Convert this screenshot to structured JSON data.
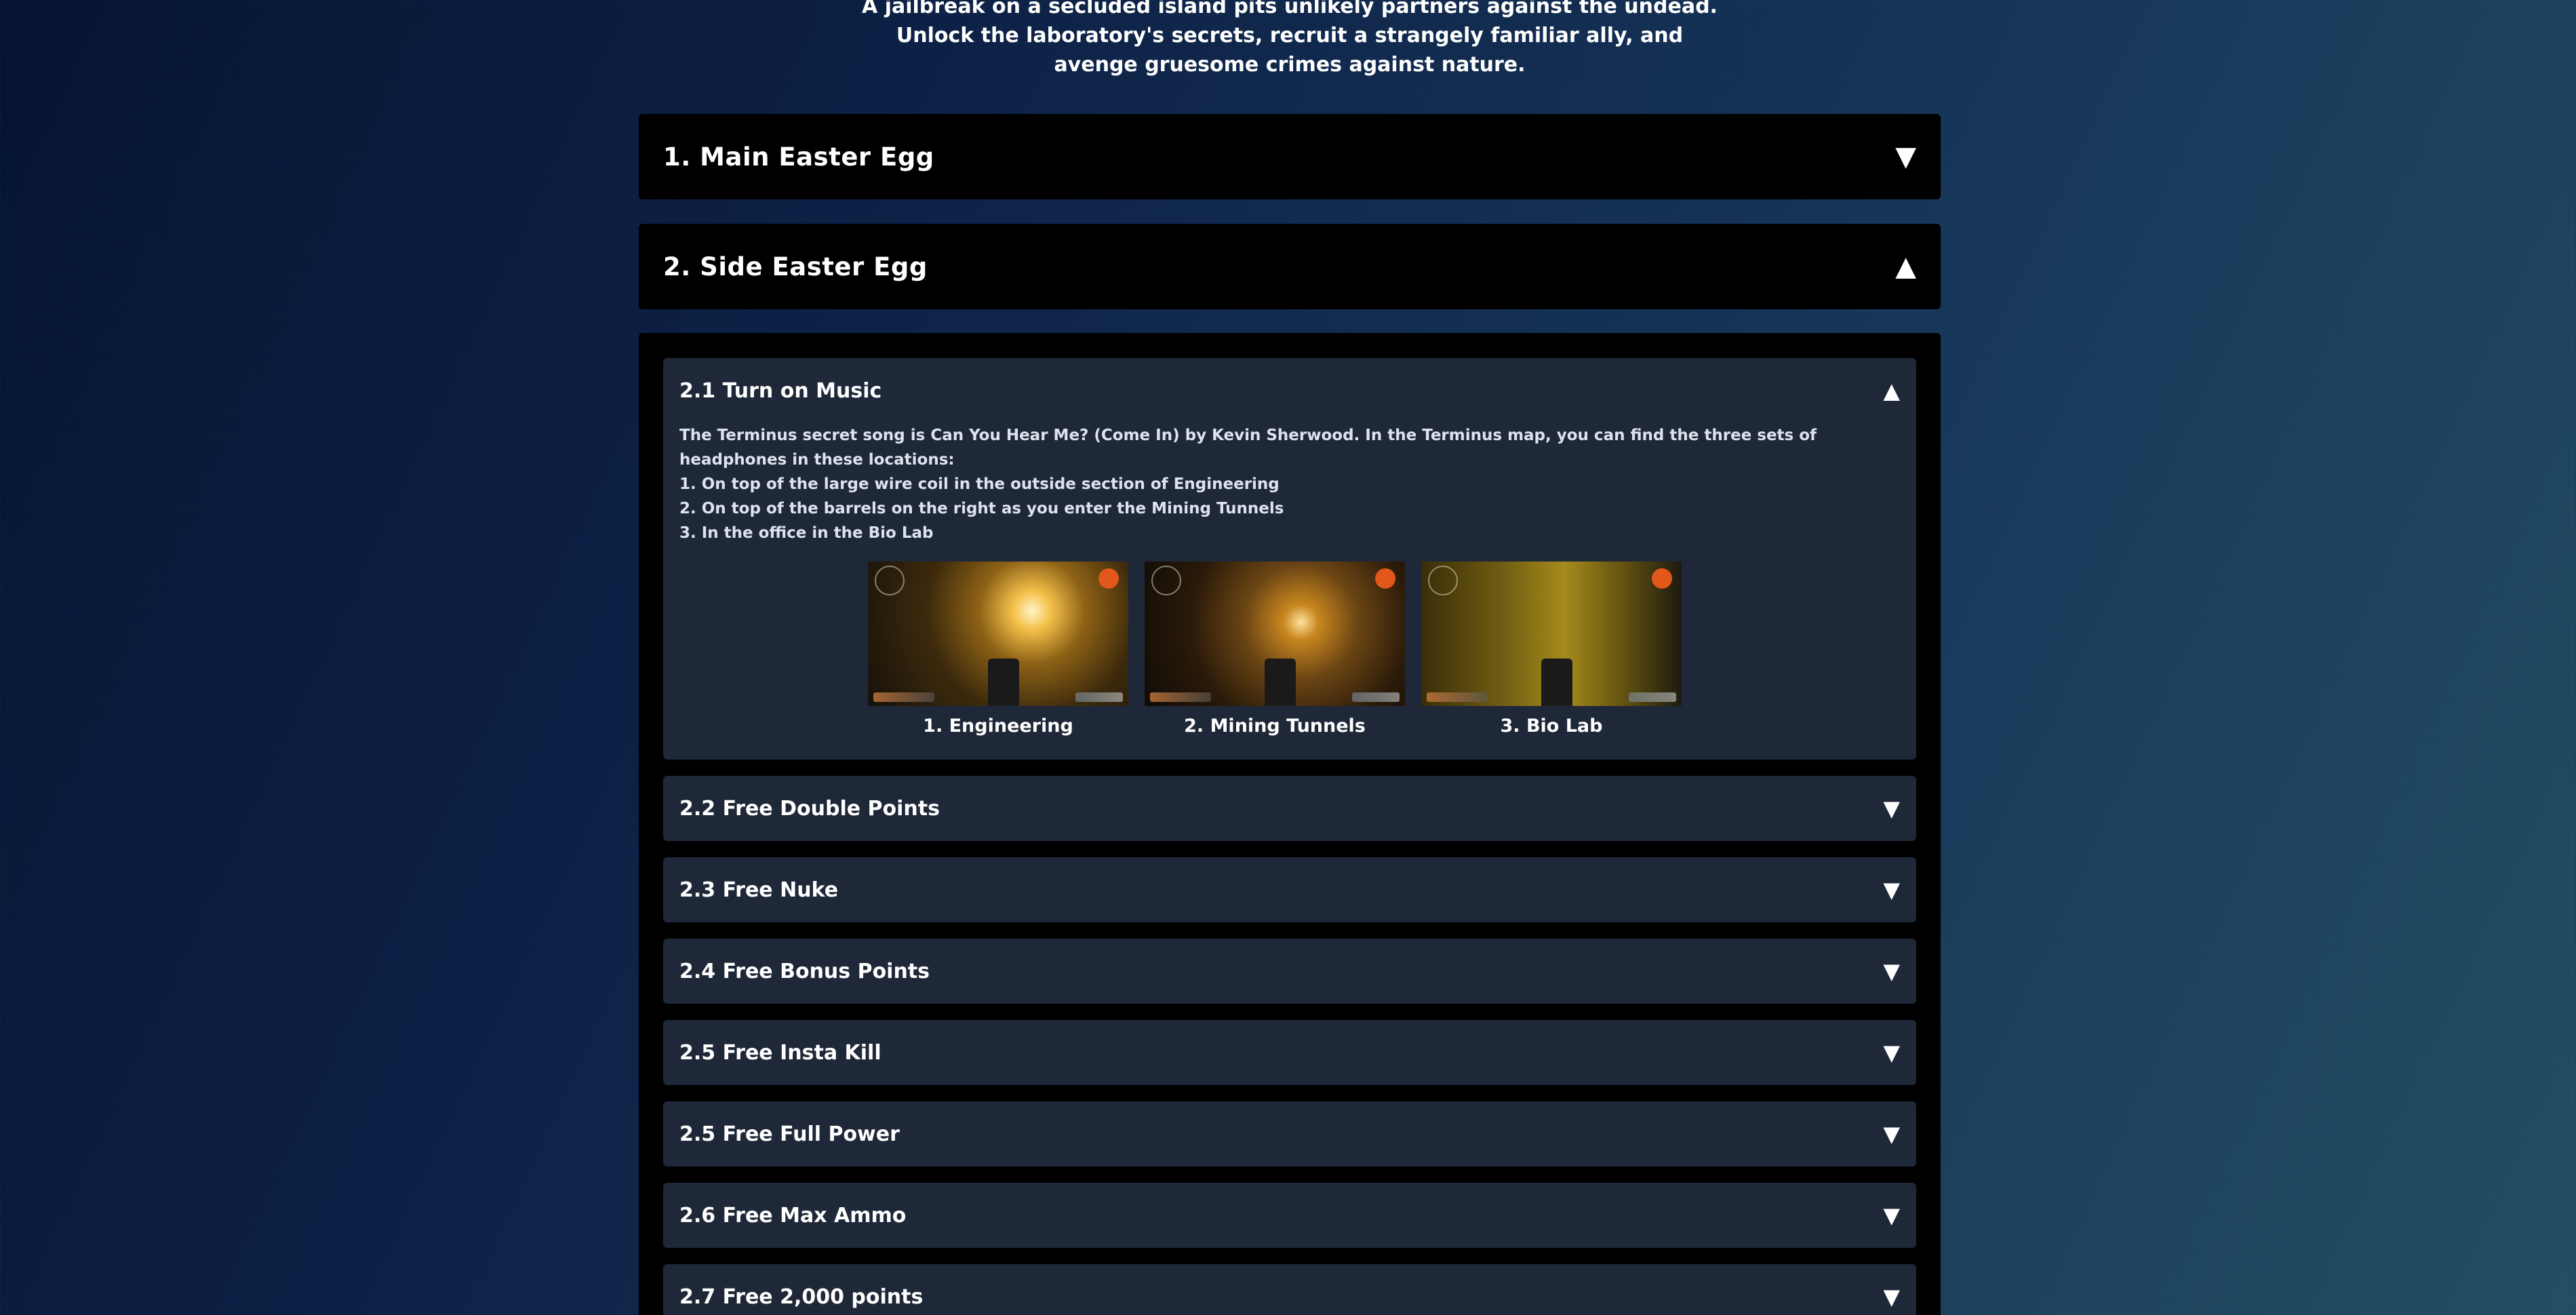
{
  "intro": {
    "line1": "A jailbreak on a secluded island pits unlikely partners against the undead.",
    "line2": "Unlock the laboratory's secrets, recruit a strangely familiar ally, and",
    "line3": "avenge gruesome crimes against nature."
  },
  "sections": [
    {
      "title": "1. Main Easter Egg",
      "arrow": "▼"
    },
    {
      "title": "2. Side Easter Egg",
      "arrow": "▲"
    }
  ],
  "side_egg": {
    "expanded": {
      "title": "2.1 Turn on Music",
      "arrow": "▲",
      "description_line1": "The Terminus secret song is Can You Hear Me? (Come In) by Kevin Sherwood. In the Terminus map, you can find the three sets of",
      "description_line2": "headphones in these locations:",
      "steps": [
        "1. On top of the large wire coil in the outside section of Engineering",
        "2. On top of the barrels on the right as you enter the Mining Tunnels",
        "3. In the office in the Bio Lab"
      ],
      "images": [
        {
          "caption": "1. Engineering"
        },
        {
          "caption": "2. Mining Tunnels"
        },
        {
          "caption": "3. Bio Lab"
        }
      ]
    },
    "collapsed": [
      {
        "title": "2.2 Free Double Points",
        "arrow": "▼"
      },
      {
        "title": "2.3 Free Nuke",
        "arrow": "▼"
      },
      {
        "title": "2.4 Free Bonus Points",
        "arrow": "▼"
      },
      {
        "title": "2.5 Free Insta Kill",
        "arrow": "▼"
      },
      {
        "title": "2.5 Free Full Power",
        "arrow": "▼"
      },
      {
        "title": "2.6 Free Max Ammo",
        "arrow": "▼"
      },
      {
        "title": "2.7 Free 2,000 points",
        "arrow": "▼"
      }
    ]
  }
}
